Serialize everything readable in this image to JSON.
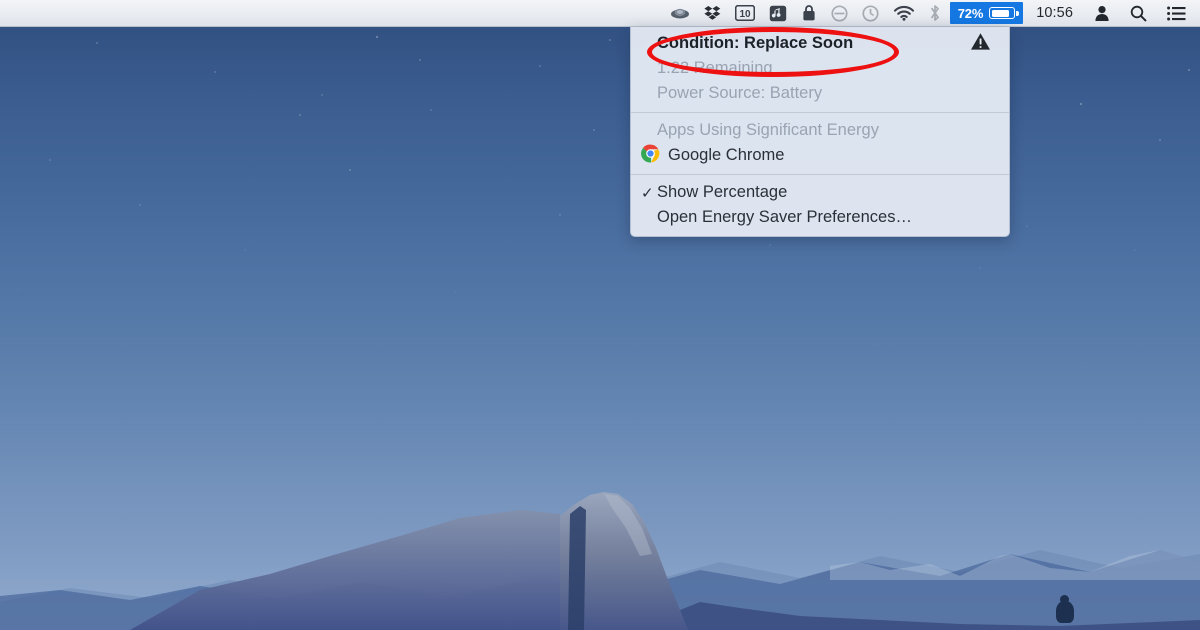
{
  "menubar": {
    "extras": [
      {
        "name": "unknown-app-icon",
        "icon": "saucer-icon",
        "dimmed": false
      },
      {
        "name": "dropbox-icon",
        "icon": "dropbox-icon",
        "dimmed": false
      },
      {
        "name": "ten-badge-icon",
        "icon": "number-10-icon",
        "label": "10",
        "dimmed": false
      },
      {
        "name": "music-note-icon",
        "icon": "music-note-icon",
        "dimmed": false
      },
      {
        "name": "lock-icon",
        "icon": "lock-icon",
        "dimmed": false
      },
      {
        "name": "do-not-disturb-icon",
        "icon": "prohibited-icon",
        "dimmed": true
      },
      {
        "name": "time-machine-icon",
        "icon": "clock-arrow-icon",
        "dimmed": true
      },
      {
        "name": "wifi-icon",
        "icon": "wifi-icon",
        "dimmed": false
      },
      {
        "name": "bluetooth-icon",
        "icon": "bluetooth-icon",
        "dimmed": true
      }
    ],
    "battery": {
      "percentage": "72%",
      "fill_level": 72,
      "selected": true,
      "highlight_color": "#1578e2"
    },
    "clock": "10:56",
    "right_icons": [
      {
        "name": "user-account-icon",
        "icon": "person-icon"
      },
      {
        "name": "spotlight-search-icon",
        "icon": "magnifier-icon"
      },
      {
        "name": "notification-center-icon",
        "icon": "list-lines-icon"
      }
    ]
  },
  "battery_menu": {
    "condition_label": "Condition: Replace Soon",
    "warning_icon": "warning-triangle-icon",
    "time_remaining": "1:22 Remaining",
    "power_source": "Power Source: Battery",
    "apps_section_header": "Apps Using Significant Energy",
    "apps": [
      {
        "name": "Google Chrome",
        "icon": "chrome-icon"
      }
    ],
    "show_percentage": {
      "label": "Show Percentage",
      "checked": true,
      "check_glyph": "✓"
    },
    "open_preferences": "Open Energy Saver Preferences…"
  },
  "annotation": {
    "shape": "ellipse",
    "color": "#ee1111",
    "targets": "Condition: Replace Soon"
  },
  "desktop": {
    "wallpaper_name": "Yosemite Half Dome night sky"
  }
}
